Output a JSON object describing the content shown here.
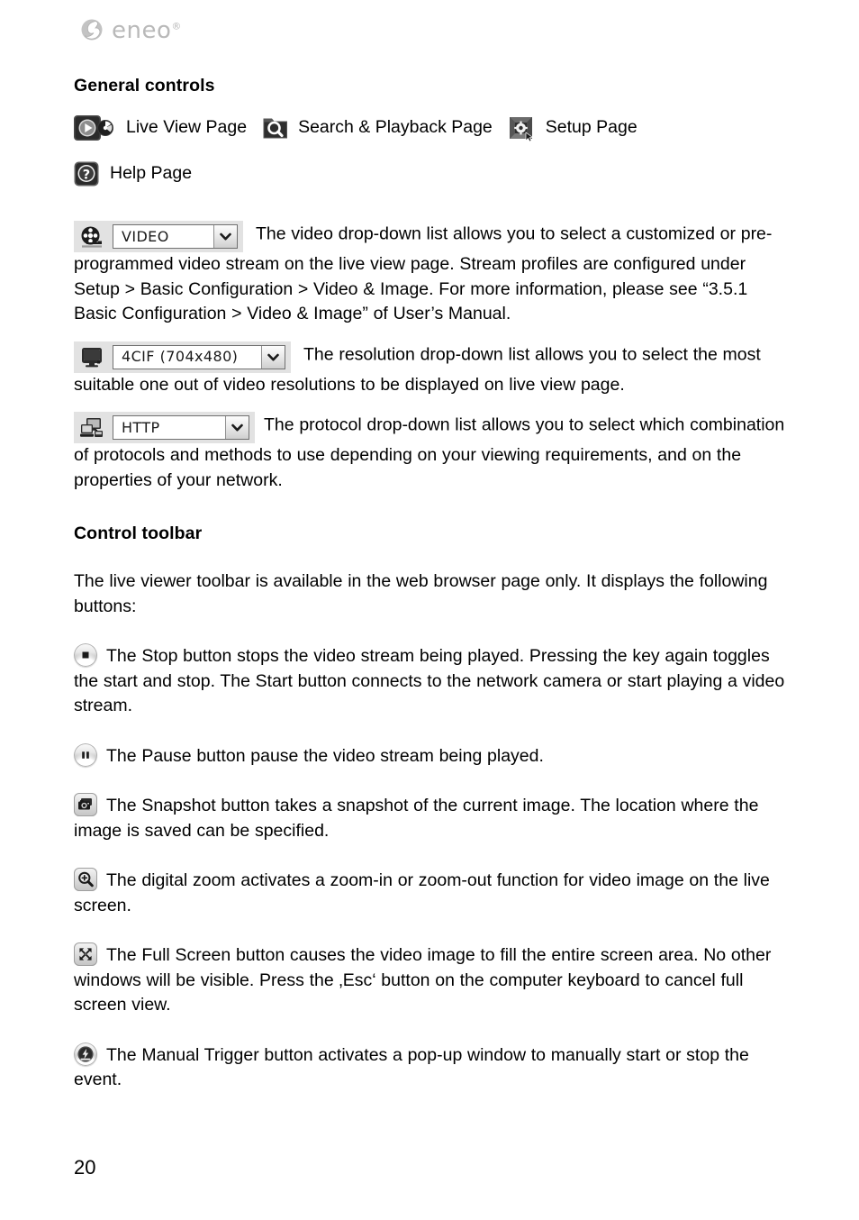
{
  "brand": {
    "name": "eneo",
    "trademark": "®",
    "logo_icon": "eneo-swirl-logo"
  },
  "sections": {
    "general_controls": {
      "heading": "General controls",
      "page_links": [
        {
          "icon": "live-view-icon",
          "label": "Live View Page"
        },
        {
          "icon": "search-playback-icon",
          "label": "Search & Playback Page"
        },
        {
          "icon": "setup-gear-icon",
          "label": "Setup Page"
        },
        {
          "icon": "help-question-icon",
          "label": "Help Page"
        }
      ],
      "dropdowns": [
        {
          "icon": "film-reel-icon",
          "value": "VIDEO",
          "arrow": "chevron-down-icon",
          "description": "The video drop-down list allows you to select a customized or pre-programmed video stream on the live view page. Stream profiles are configured under Setup > Basic Configuration > Video & Image. For more information, please see “3.5.1 Basic Configuration > Video & Image” of User’s Manual."
        },
        {
          "icon": "monitor-icon",
          "value": "4CIF  (704x480)",
          "arrow": "chevron-down-icon",
          "description": "The resolution drop-down list allows you to select the most suitable one out of video resolutions to be displayed on live view page."
        },
        {
          "icon": "network-computers-icon",
          "value": "HTTP",
          "arrow": "chevron-down-icon",
          "description": "The protocol drop-down list allows you to select which combination of protocols and methods to use depending on your viewing requirements, and on the properties of your network."
        }
      ]
    },
    "control_toolbar": {
      "heading": "Control toolbar",
      "intro": "The live viewer toolbar is available in the web browser page only. It displays the following buttons:",
      "buttons": [
        {
          "icon": "stop-button-icon",
          "description": "The Stop button stops the video stream being played. Pressing the key again toggles the start and stop. The Start button connects to the network camera or start playing a video stream."
        },
        {
          "icon": "pause-button-icon",
          "description": "The Pause button pause the video stream being played."
        },
        {
          "icon": "snapshot-camera-icon",
          "description": "The Snapshot button takes a snapshot of the current image. The location where the image is saved can be specified."
        },
        {
          "icon": "digital-zoom-icon",
          "description": "The digital zoom activates a zoom-in or zoom-out function for video image on the live screen."
        },
        {
          "icon": "full-screen-icon",
          "description": "The Full Screen button causes the video image to fill the entire screen area. No other windows will be visible. Press the ‚Esc‘ button on the computer keyboard to cancel full screen view."
        },
        {
          "icon": "manual-trigger-icon",
          "description": "The Manual Trigger button activates a pop-up window to manually start or stop the event."
        }
      ]
    }
  },
  "footer": {
    "page_number": "20"
  },
  "colors": {
    "text": "#000000",
    "logo": "#b9b9b9",
    "widget_panel": "#e2e2e2"
  }
}
